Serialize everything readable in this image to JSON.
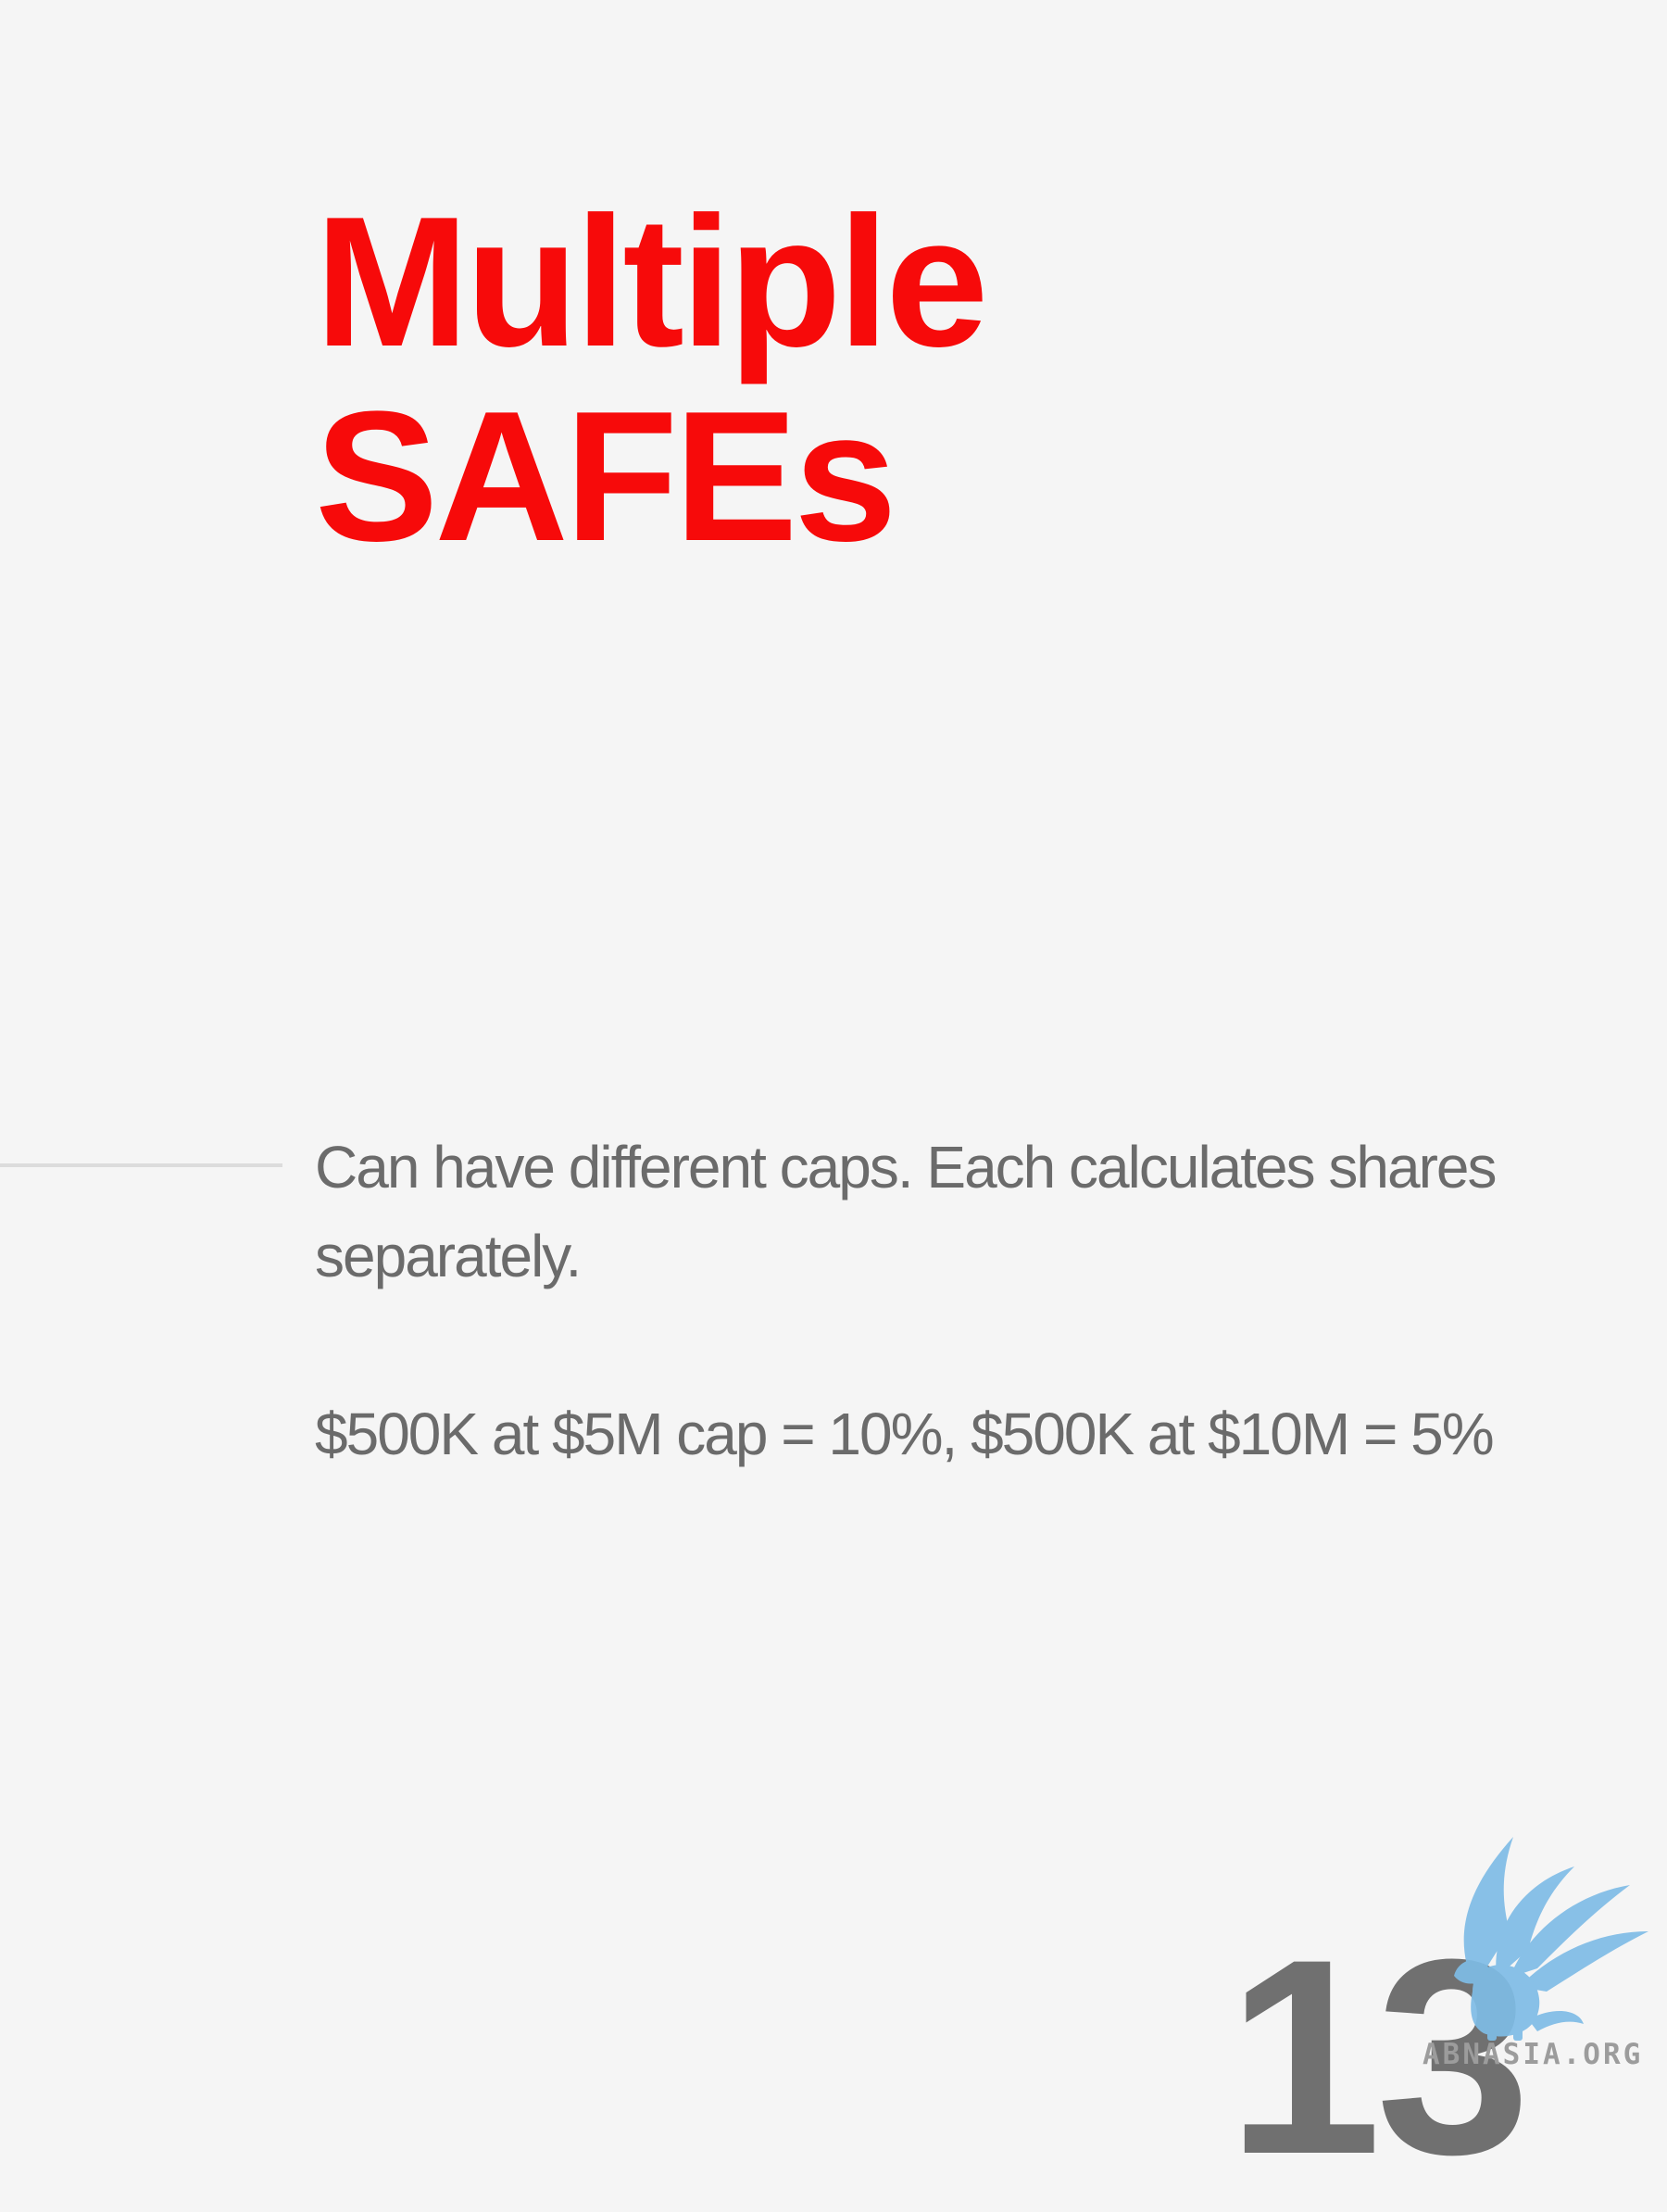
{
  "slide": {
    "title_lines": [
      "Multiple",
      "SAFEs"
    ],
    "body": {
      "paragraph_1": "Can have different caps. Each calculates shares separately.",
      "paragraph_2": "$500K at $5M cap = 10%, $500K at $10M = 5%"
    },
    "page_number": "13"
  },
  "brand": {
    "logo_icon": "griffin-icon",
    "watermark_text": "ABNASIA.ORG"
  },
  "colors": {
    "background": "#f5f5f5",
    "title": "#f70a0a",
    "body_text": "#6b6b6b",
    "page_number": "#707070",
    "logo": "#7fbce6"
  }
}
